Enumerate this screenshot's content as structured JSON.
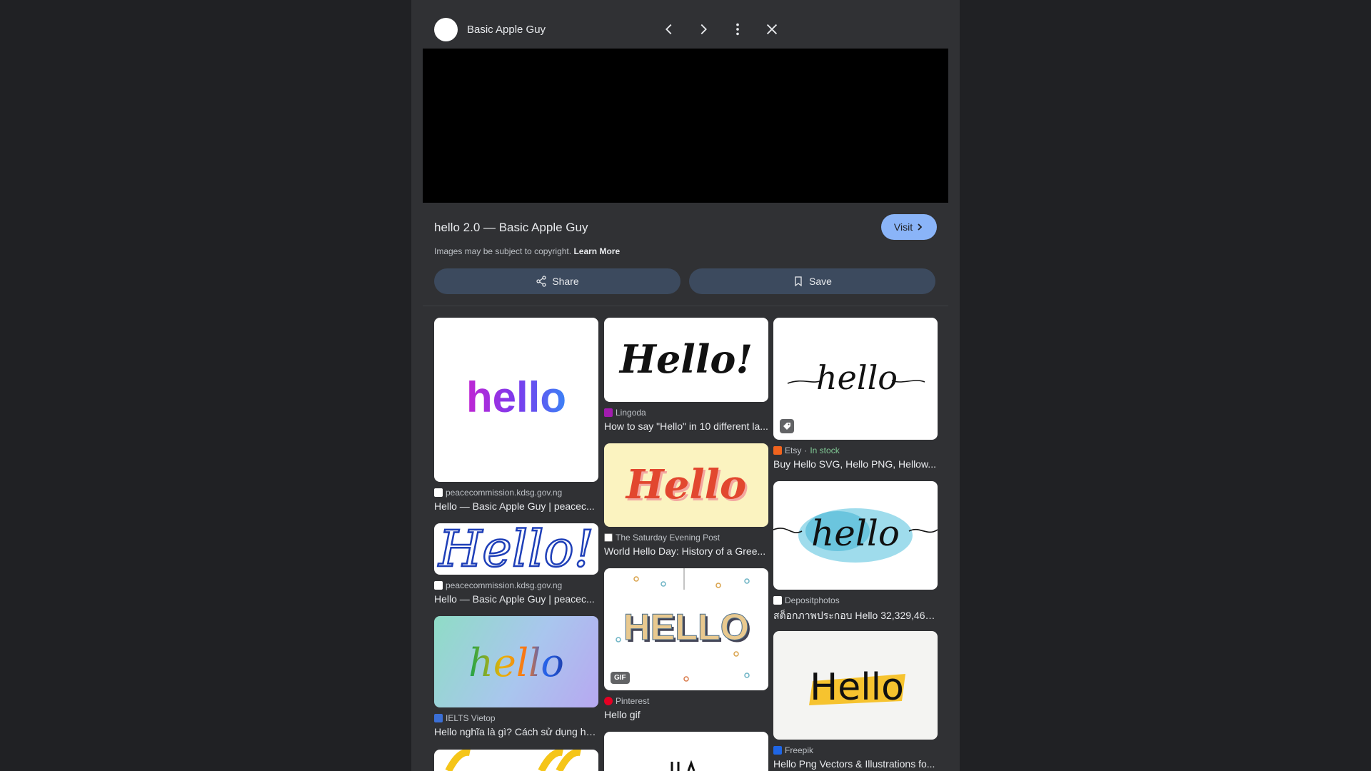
{
  "header": {
    "site_name": "Basic Apple Guy",
    "icons": [
      "chevron-left-icon",
      "chevron-right-icon",
      "more-vert-icon",
      "close-icon"
    ]
  },
  "detail": {
    "title": "hello 2.0 — Basic Apple Guy",
    "visit_label": "Visit",
    "copyright_text": "Images may be subject to copyright.",
    "learn_more": "Learn More",
    "share_label": "Share",
    "save_label": "Save"
  },
  "colors": {
    "panel_bg": "#303134",
    "page_bg": "#202124",
    "accent": "#8ab4f8",
    "button_bg": "#3c4a5e",
    "in_stock": "#81c995"
  },
  "results": {
    "col1": [
      {
        "source": "peacecommission.kdsg.gov.ng",
        "caption": "Hello — Basic Apple Guy | peacec..."
      },
      {
        "source": "peacecommission.kdsg.gov.ng",
        "caption": "Hello — Basic Apple Guy | peacec..."
      },
      {
        "source": "IELTS Vietop",
        "caption": "Hello nghĩa là gì? Cách sử dụng he..."
      }
    ],
    "col2": [
      {
        "source": "Lingoda",
        "caption": "How to say \"Hello\" in 10 different la..."
      },
      {
        "source": "The Saturday Evening Post",
        "caption": "World Hello Day: History of a Gree..."
      },
      {
        "source": "Pinterest",
        "caption": "Hello gif",
        "badge": "GIF"
      }
    ],
    "col3": [
      {
        "source": "Etsy",
        "source_suffix": "In stock",
        "caption": "Buy Hello SVG, Hello PNG, Hellow..."
      },
      {
        "source": "Depositphotos",
        "caption": "สต็อกภาพประกอบ Hello 32,329,463 |..."
      },
      {
        "source": "Freepik",
        "caption": "Hello Png Vectors & Illustrations fo..."
      }
    ]
  },
  "thumb_text": {
    "hello_gradient": "hello",
    "hello_script_excl": "Hello!",
    "hello_line": "hello",
    "hello_blue": "Hello!",
    "hello_red": "Hello",
    "hello_watercolor": "hello",
    "hello_rainbow": "hello",
    "hello_blocks": "HELLO",
    "hello_yellow": "Hello"
  }
}
